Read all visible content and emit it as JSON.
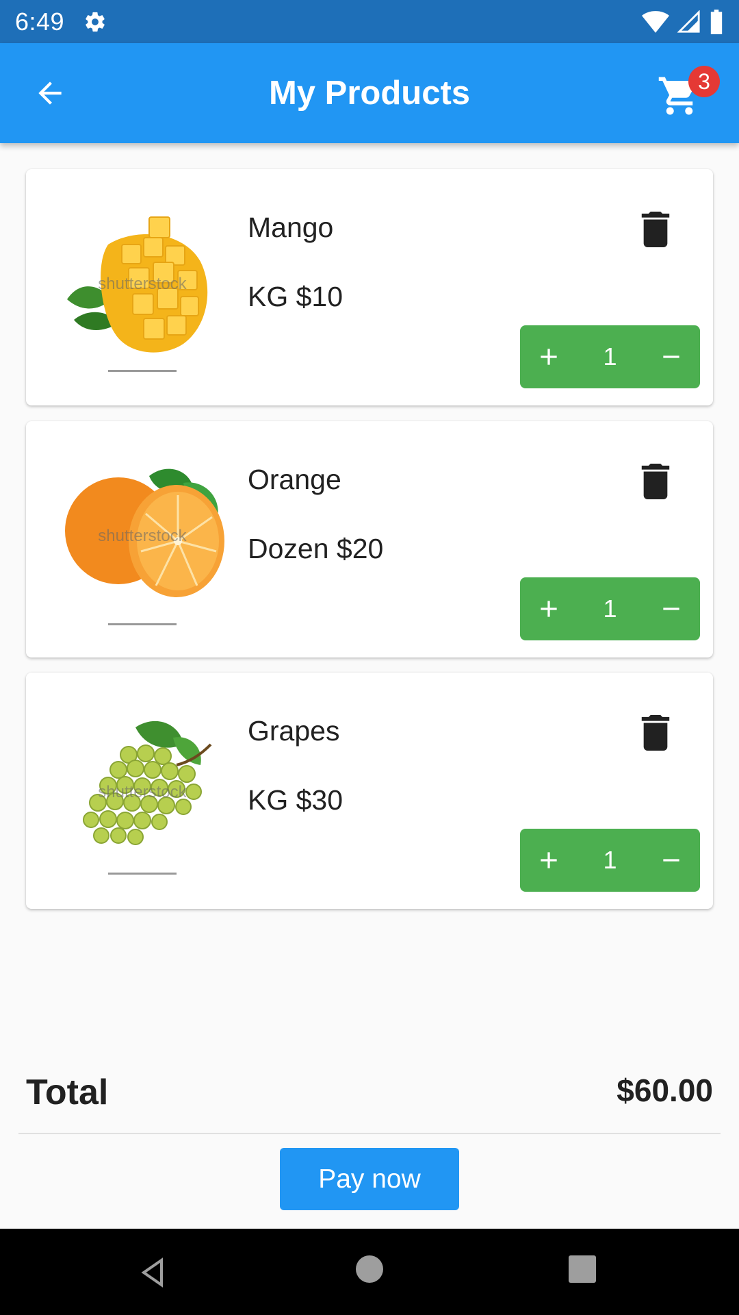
{
  "status_bar": {
    "time": "6:49",
    "icons": [
      "gear-icon",
      "wifi-icon",
      "signal-icon",
      "battery-icon"
    ]
  },
  "app_bar": {
    "title": "My Products",
    "back_icon": "arrow-back-icon",
    "cart_icon": "shopping-cart-icon",
    "cart_count": "3",
    "color": "#2196f3"
  },
  "products": [
    {
      "name": "Mango",
      "price": "KG $10",
      "quantity": "1",
      "watermark": "shutterstock",
      "image": "mango-image"
    },
    {
      "name": "Orange",
      "price": "Dozen $20",
      "quantity": "1",
      "watermark": "shutterstock",
      "image": "orange-image"
    },
    {
      "name": "Grapes",
      "price": "KG $30",
      "quantity": "1",
      "watermark": "shutterstock",
      "image": "grapes-image"
    }
  ],
  "stepper_color": "#4caf50",
  "total": {
    "label": "Total",
    "value": "$60.00"
  },
  "pay_button": {
    "label": "Pay now"
  },
  "nav_bar": {
    "icons": [
      "nav-back-icon",
      "nav-home-icon",
      "nav-recents-icon"
    ]
  }
}
